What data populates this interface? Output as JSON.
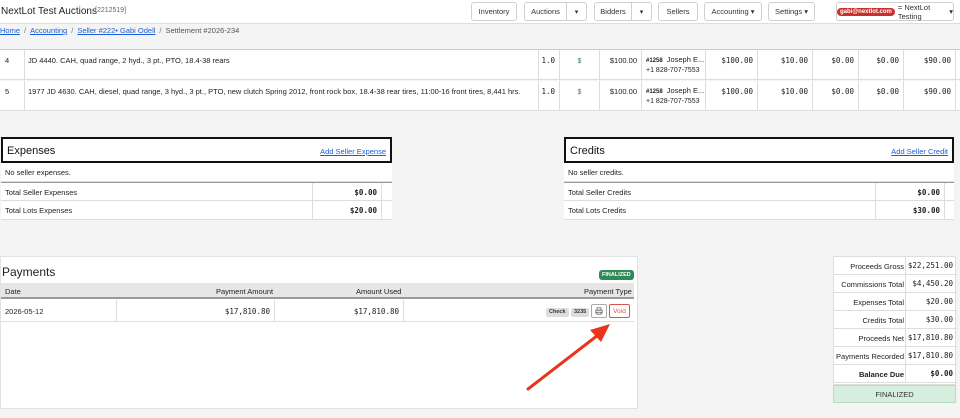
{
  "app": {
    "title": "NextLot Test Auctions",
    "id": "[2212519]"
  },
  "nav": {
    "inventory": "Inventory",
    "auctions": "Auctions",
    "bidders": "Bidders",
    "sellers": "Sellers",
    "accounting": "Accounting",
    "settings": "Settings",
    "user_email": "gabi@nextlot.com",
    "user_org": "= NextLot Testing",
    "caret": "▾"
  },
  "breadcrumb": {
    "items": [
      "Home",
      "Accounting",
      "Seller #222• Gabi Odell",
      "Settlement #2026-234"
    ],
    "sep": "/"
  },
  "lots": [
    {
      "num": "4",
      "desc": "JD 4440. CAH, quad range, 2 hyd., 3 pt., PTO, 18.4-38 rears",
      "qty": "1.0",
      "price": "$100.00",
      "bidder_tag": "#1258",
      "bidder_name": "Joseph E...",
      "bidder_phone": "+1 828-707-7553",
      "amount": "$100.00",
      "fee1": "$10.00",
      "fee2": "$0.00",
      "fee3": "$0.00",
      "net": "$90.00"
    },
    {
      "num": "5",
      "desc": "1977 JD 4630. CAH, diesel, quad range, 3 hyd., 3 pt., PTO, new clutch Spring 2012, front rock box, 18.4-38 rear tires, 11:00-16 front tires, 8,441 hrs.",
      "qty": "1.0",
      "price": "$100.00",
      "bidder_tag": "#1258",
      "bidder_name": "Joseph E...",
      "bidder_phone": "+1 828-707-7553",
      "amount": "$100.00",
      "fee1": "$10.00",
      "fee2": "$0.00",
      "fee3": "$0.00",
      "net": "$90.00"
    }
  ],
  "expenses": {
    "title": "Expenses",
    "add_link": "Add Seller Expense",
    "empty": "No seller expenses.",
    "rows": [
      {
        "label": "Total Seller Expenses",
        "value": "$0.00"
      },
      {
        "label": "Total Lots Expenses",
        "value": "$20.00"
      }
    ]
  },
  "credits": {
    "title": "Credits",
    "add_link": "Add Seller Credit",
    "empty": "No seller credits.",
    "rows": [
      {
        "label": "Total Seller Credits",
        "value": "$0.00"
      },
      {
        "label": "Total Lots Credits",
        "value": "$30.00"
      }
    ]
  },
  "payments": {
    "title": "Payments",
    "badge": "FINALIZED",
    "columns": [
      "Date",
      "Payment Amount",
      "Amount Used",
      "Payment Type"
    ],
    "row": {
      "date": "2026-05-12",
      "amount": "$17,810.80",
      "used": "$17,810.80",
      "type": "Check",
      "check_no": "3235",
      "void_label": "Void"
    }
  },
  "summary": {
    "rows": [
      {
        "label": "Proceeds Gross",
        "value": "$22,251.00"
      },
      {
        "label": "Commissions Total",
        "value": "$4,450.20"
      },
      {
        "label": "Expenses Total",
        "value": "$20.00"
      },
      {
        "label": "Credits Total",
        "value": "$30.00"
      },
      {
        "label": "Proceeds Net",
        "value": "$17,810.80"
      },
      {
        "label": "Payments Recorded",
        "value": "$17,810.80"
      },
      {
        "label": "Balance Due",
        "value": "$0.00"
      }
    ],
    "status": "FINALIZED"
  },
  "colors": {
    "annotation_arrow": "#e8341c",
    "link": "#1a5fd6",
    "finalized": "#2e8b57",
    "void": "#d9534f"
  },
  "icons": {
    "dollar": "dollar-icon",
    "print": "printer-icon"
  }
}
